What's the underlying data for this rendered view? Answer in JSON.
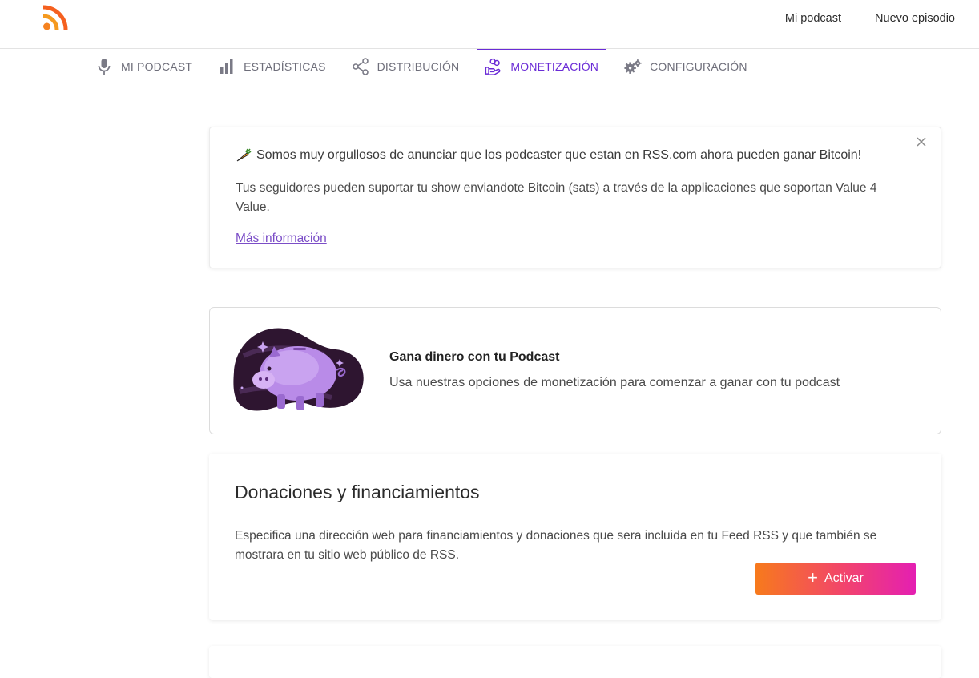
{
  "header": {
    "links": [
      "Mi podcast",
      "Nuevo episodio"
    ]
  },
  "tabs": [
    {
      "label": "MI PODCAST",
      "icon": "microphone-icon",
      "active": false
    },
    {
      "label": "ESTADÍSTICAS",
      "icon": "bar-chart-icon",
      "active": false
    },
    {
      "label": "DISTRIBUCIÓN",
      "icon": "share-icon",
      "active": false
    },
    {
      "label": "MONETIZACIÓN",
      "icon": "hand-coins-icon",
      "active": true
    },
    {
      "label": "CONFIGURACIÓN",
      "icon": "gears-icon",
      "active": false
    }
  ],
  "announcement": {
    "headline": "Somos muy orgullosos de anunciar que los podcaster que estan en RSS.com ahora pueden ganar Bitcoin!",
    "body": "Tus seguidores pueden suportar tu show enviandote Bitcoin (sats) a través de la applicaciones que soportan Value 4 Value.",
    "more_link": "Más información"
  },
  "promo": {
    "title": "Gana dinero con tu Podcast",
    "description": "Usa nuestras opciones de monetización para comenzar a ganar con tu podcast"
  },
  "donations": {
    "title": "Donaciones y financiamientos",
    "description": "Especifica una dirección web para financiamientos y donaciones que sera incluida en tu Feed RSS y que también se mostrara en tu sitio web público de RSS.",
    "button_label": "Activar"
  },
  "colors": {
    "accent": "#6a2bd6",
    "button_gradient_start": "#f77a1c",
    "button_gradient_end": "#e41fb2",
    "logo_orange": "#f5821f"
  }
}
